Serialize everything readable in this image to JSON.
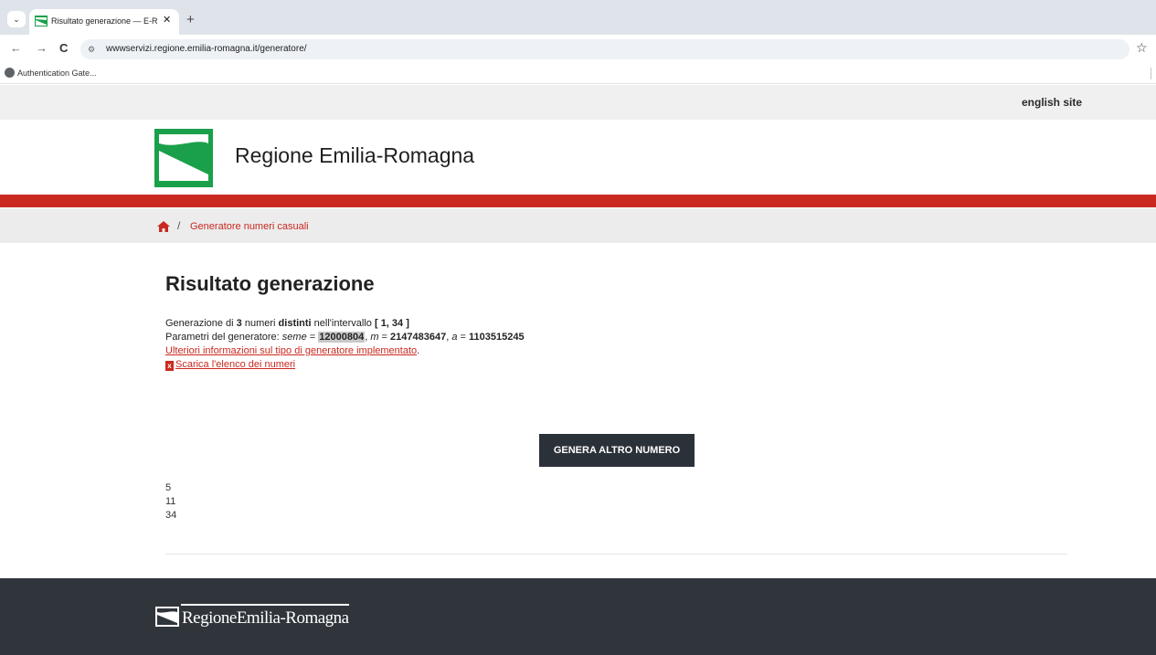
{
  "browser": {
    "tab_title": "Risultato generazione — E-R | ",
    "tab_close": "✕",
    "new_tab": "+",
    "url": "wwwservizi.regione.emilia-romagna.it/generatore/",
    "bookmark": "Authentication Gate...",
    "back": "←",
    "forward": "→",
    "reload": "C",
    "site_info": "⚙",
    "star": "☆",
    "tab_menu": "⌄"
  },
  "page": {
    "english_site": "english site",
    "site_title": "Regione Emilia-Romagna",
    "breadcrumb": {
      "separator": "/",
      "current": "Generatore numeri casuali"
    },
    "title": "Risultato generazione",
    "info": {
      "line1": {
        "prefix": "Generazione di ",
        "count": "3",
        "mid1": " numeri ",
        "distinct": "distinti",
        "mid2": " nell'intervallo ",
        "range": "[ 1, 34 ]"
      },
      "line2": {
        "prefix": "Parametri del generatore: ",
        "seed_label": "seme",
        "eq1": " = ",
        "seed": "12000804",
        "sep1": ", ",
        "m_label": "m",
        "eq2": " = ",
        "m": "2147483647",
        "sep2": ", ",
        "a_label": "a",
        "eq3": " = ",
        "a": "1103515245"
      },
      "more_info_link": "Ulteriori informazioni sul tipo di generatore implementato",
      "more_info_suffix": ".",
      "download_icon_glyph": "x",
      "download_link": "Scarica l'elenco dei numeri"
    },
    "generate_button": "GENERA ALTRO NUMERO",
    "numbers": [
      "5",
      "11",
      "34"
    ],
    "footer_brand": "RegioneEmilia-Romagna"
  },
  "colors": {
    "accent_red": "#c9291f",
    "brand_green": "#1aa04a",
    "footer_bg": "#30353b",
    "button_bg": "#2b3138"
  },
  "icons": [
    "home-icon",
    "excel-file-icon",
    "region-logo-icon",
    "star-icon"
  ]
}
